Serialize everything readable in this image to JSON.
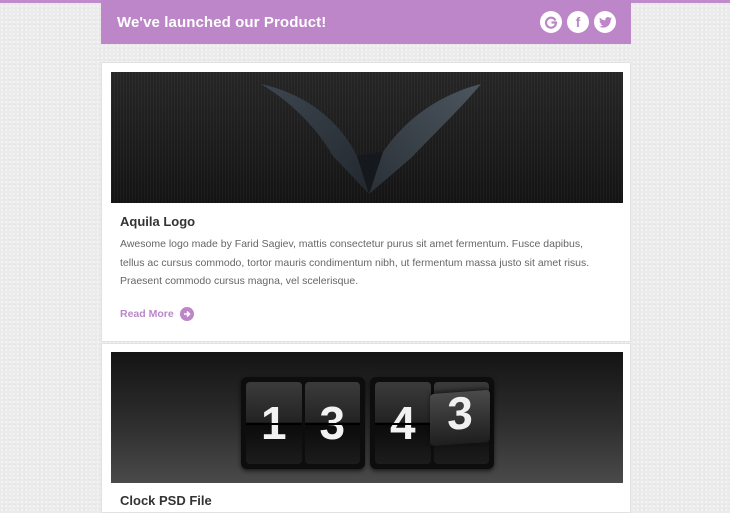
{
  "header": {
    "title": "We've launched our Product!",
    "social": [
      {
        "icon": "google-icon",
        "glyph": "G"
      },
      {
        "icon": "facebook-icon",
        "glyph": "f"
      },
      {
        "icon": "twitter-icon",
        "glyph": ""
      }
    ]
  },
  "posts": [
    {
      "title": "Aquila Logo",
      "description": "Awesome logo made by Farid Sagiev, mattis consectetur purus sit amet fermentum. Fusce dapibus, tellus ac cursus commodo, tortor mauris condimentum nibh, ut fermentum massa justo sit amet risus. Praesent commodo cursus magna, vel scelerisque.",
      "read_more": "Read More"
    },
    {
      "title": "Clock PSD File",
      "clock": {
        "hours": [
          "1",
          "3"
        ],
        "minutes": [
          "4",
          "3"
        ],
        "flipping": "3"
      }
    }
  ],
  "colors": {
    "accent": "#bc86c8"
  }
}
